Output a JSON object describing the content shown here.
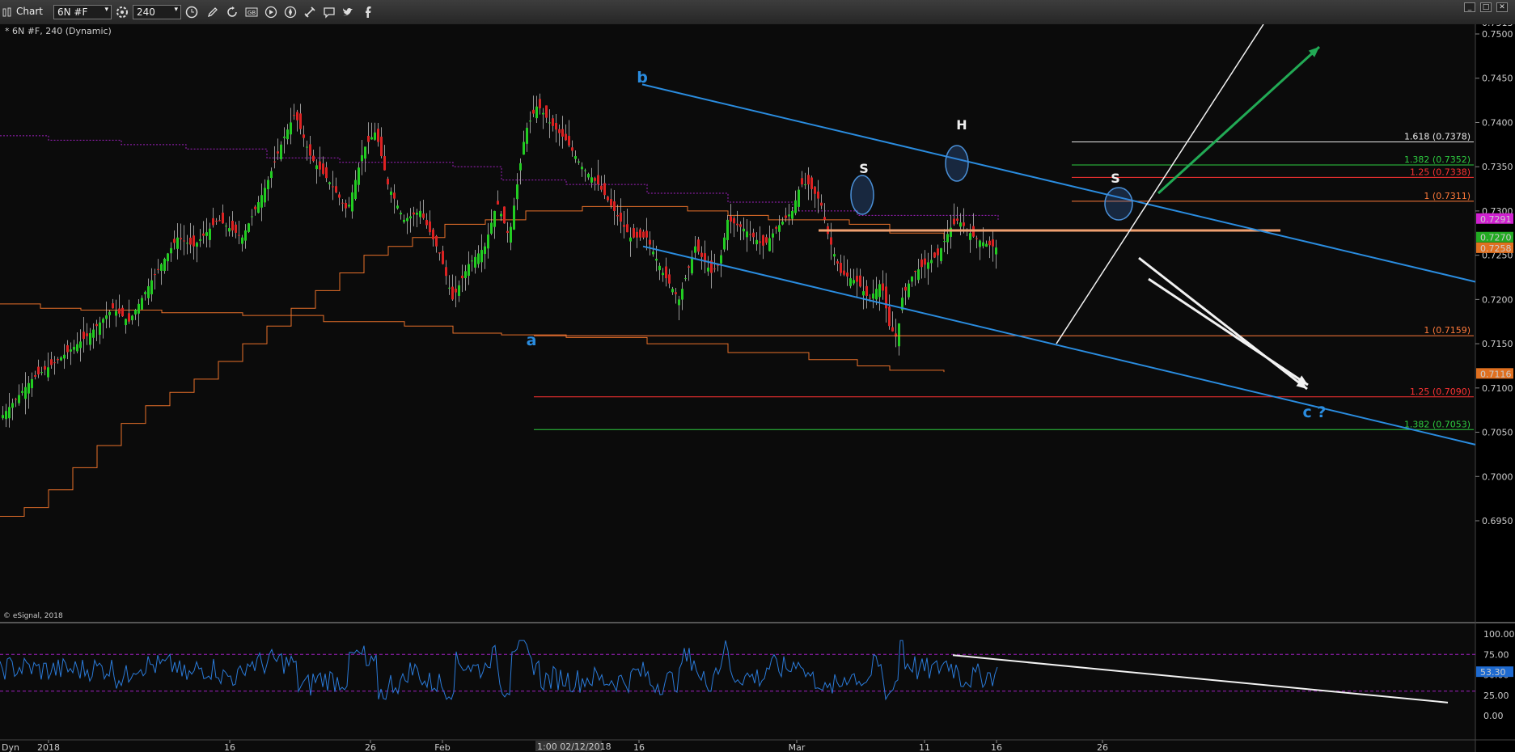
{
  "toolbar": {
    "app_title": "Chart",
    "symbol": "6N #F",
    "interval": "240",
    "icons": [
      "settings-icon",
      "clock-icon",
      "pencil-icon",
      "refresh-icon",
      "news-icon",
      "play-icon",
      "compass-icon",
      "tools-icon",
      "comment-icon",
      "twitter-icon",
      "facebook-icon"
    ]
  },
  "window_controls": [
    "minimize",
    "maximize",
    "close"
  ],
  "chart_header": "* 6N #F, 240 (Dynamic)",
  "copyright": "© eSignal, 2018",
  "indicator_label": "Dyn",
  "date_box": "1:00 02/12/2018",
  "price_axis": [
    "0.7513",
    "0.7500",
    "0.7450",
    "0.7400",
    "0.7350",
    "0.7300",
    "0.7250",
    "0.7200",
    "0.7150",
    "0.7100",
    "0.7050",
    "0.7000",
    "0.6950"
  ],
  "price_markers": [
    {
      "label": "0.7291",
      "color": "#d020d0"
    },
    {
      "label": "0.7270",
      "color": "#22aa22"
    },
    {
      "label": "0.7258",
      "color": "#e07020"
    },
    {
      "label": "0.7116",
      "color": "#e07020"
    }
  ],
  "rsi_axis": [
    "100.00",
    "75.00",
    "50.00",
    "25.00",
    "0.00"
  ],
  "rsi_marker": "53.30",
  "time_axis": [
    "2018",
    "16",
    "26",
    "Feb",
    "16",
    "Mar",
    "11",
    "16",
    "26"
  ],
  "fib_levels": [
    {
      "label": "1.618 (0.7378)",
      "color": "#e8e8e8"
    },
    {
      "label": "1.382 (0.7352)",
      "color": "#2ecc40"
    },
    {
      "label": "1.25 (0.7338)",
      "color": "#ff3333"
    },
    {
      "label": "1 (0.7311)",
      "color": "#ff7a3a"
    },
    {
      "label": "1 (0.7159)",
      "color": "#ff7a3a"
    },
    {
      "label": "1.25 (0.7090)",
      "color": "#ff3333"
    },
    {
      "label": "1.382 (0.7053)",
      "color": "#2ecc40"
    }
  ],
  "wave_labels": [
    "b",
    "a",
    "c ?"
  ],
  "pattern_labels": [
    "S",
    "H",
    "S"
  ],
  "colors": {
    "up_candle": "#22cc22",
    "down_candle": "#dd2222",
    "channel": "#2a8cdf",
    "orange": "#e8702a",
    "purple": "#a020c0",
    "rsi": "#2a7ad8"
  },
  "chart_data": {
    "type": "candlestick",
    "symbol": "6N #F",
    "interval": "240",
    "ylim": [
      0.6925,
      0.7515
    ],
    "rsi_ylim": [
      0,
      100
    ],
    "key_prices": {
      "wave_b_high": 0.743,
      "wave_a_low": 0.7175,
      "recent_low": 0.7152,
      "last": 0.7258
    }
  }
}
